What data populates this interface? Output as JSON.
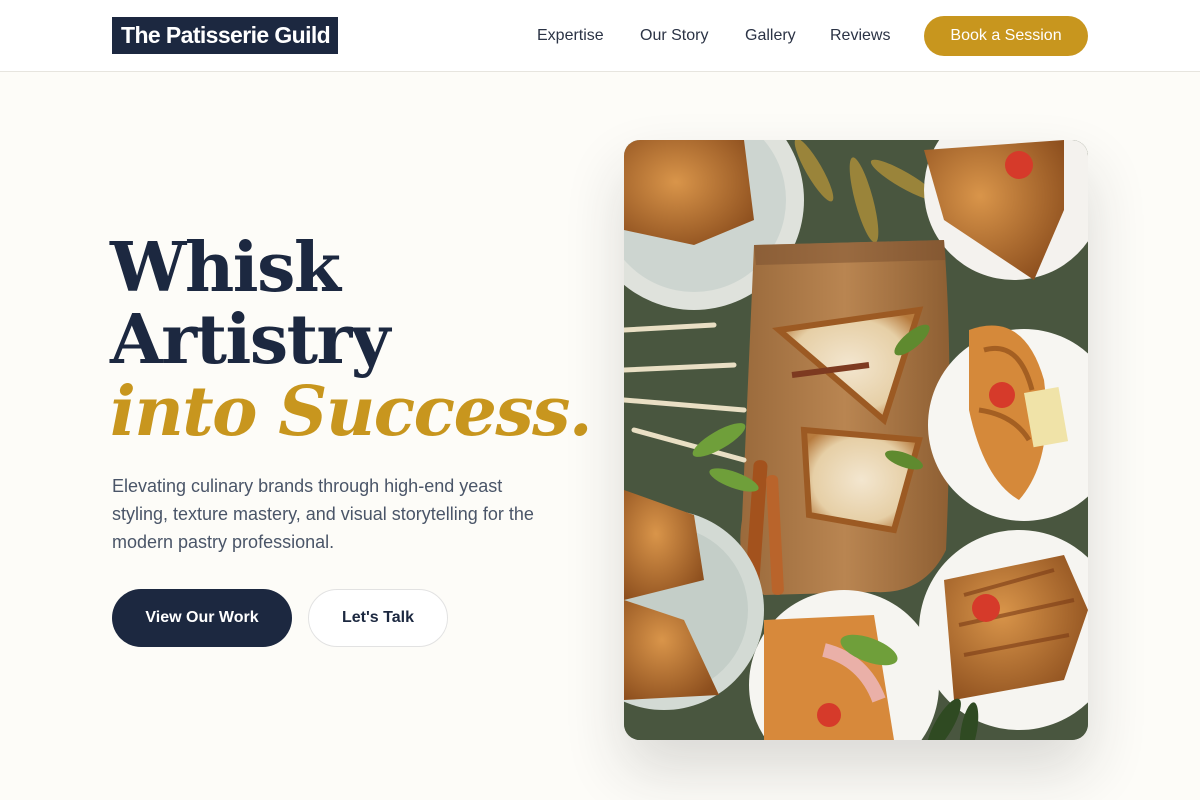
{
  "brand": {
    "name": "The Patisserie Guild"
  },
  "nav": {
    "items": [
      {
        "label": "Expertise"
      },
      {
        "label": "Our Story"
      },
      {
        "label": "Gallery"
      },
      {
        "label": "Reviews"
      }
    ],
    "cta": "Book a Session"
  },
  "hero": {
    "title_line1": "Whisk",
    "title_line2": "Artistry",
    "title_accent": "into Success.",
    "subtitle": "Elevating culinary brands through high-end yeast styling, texture mastery, and visual storytelling for the modern pastry professional.",
    "primary_button": "View Our Work",
    "secondary_button": "Let's Talk",
    "image_subject": "overhead-sandwich-platter-photo"
  },
  "colors": {
    "navy": "#1c2840",
    "gold": "#c8961e",
    "background": "#fdfcf8"
  }
}
